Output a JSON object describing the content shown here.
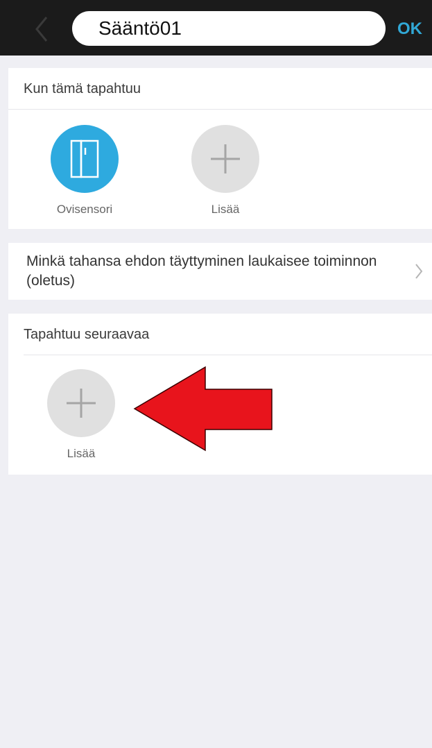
{
  "navbar": {
    "title_value": "Sääntö01",
    "ok_label": "OK"
  },
  "trigger_section": {
    "header": "Kun tämä tapahtuu",
    "items": [
      {
        "label": "Ovisensori",
        "icon": "door-sensor-icon",
        "color": "#2eaadf"
      },
      {
        "label": "Lisää",
        "icon": "plus-icon"
      }
    ]
  },
  "condition": {
    "text": "Minkä tahansa ehdon täyttyminen laukaisee toiminnon (oletus)"
  },
  "action_section": {
    "header": "Tapahtuu seuraavaa",
    "items": [
      {
        "label": "Lisää",
        "icon": "plus-icon"
      }
    ]
  },
  "annotation": {
    "arrow_color": "#e8141c",
    "arrow_direction": "left"
  }
}
